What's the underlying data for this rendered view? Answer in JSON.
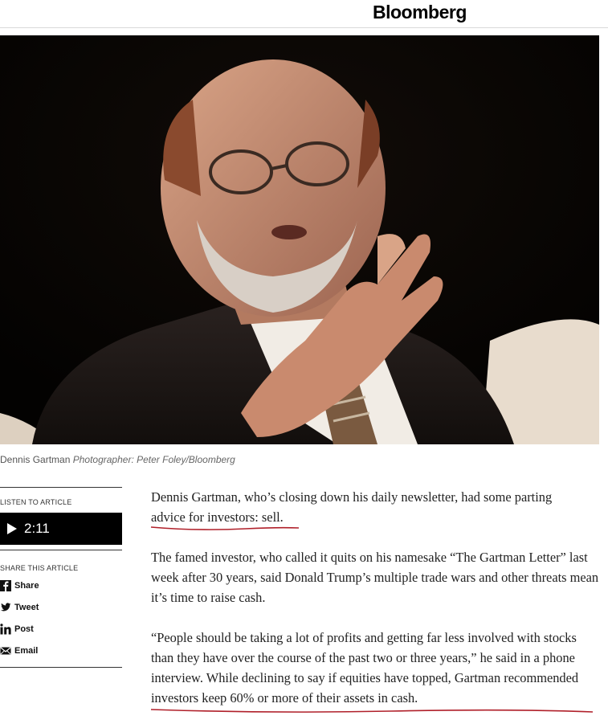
{
  "header": {
    "brand": "Bloomberg"
  },
  "hero": {
    "alt": "Dennis Gartman"
  },
  "caption": {
    "name": "Dennis Gartman",
    "credit": "Photographer: Peter Foley/Bloomberg"
  },
  "sidebar": {
    "listen_label": "LISTEN TO ARTICLE",
    "duration": "2:11",
    "share_label": "SHARE THIS ARTICLE",
    "share_items": [
      {
        "label": "Share",
        "icon": "facebook-icon"
      },
      {
        "label": "Tweet",
        "icon": "twitter-icon"
      },
      {
        "label": "Post",
        "icon": "linkedin-icon"
      },
      {
        "label": "Email",
        "icon": "email-icon"
      }
    ]
  },
  "article": {
    "p1_a": "Dennis Gartman, who’s closing down his daily newsletter, had some parting",
    "p1_b": "advice for investors: sell.",
    "p2": "The famed investor, who called it quits on his namesake “The Gartman Letter” last week after 30 years, said Donald Trump’s multiple trade wars and other threats mean it’s time to raise cash.",
    "p3_a": "“People should be taking a lot of profits and getting far less involved with stocks than they have over the course of the past two or three years,” he said in a phone interview. While declining to say if equities have topped,",
    "p3_b": "Gartman recommended investors keep 60% or more of their assets in cash."
  },
  "colors": {
    "annotation": "#b0202a",
    "hero_bg": "#060402"
  }
}
